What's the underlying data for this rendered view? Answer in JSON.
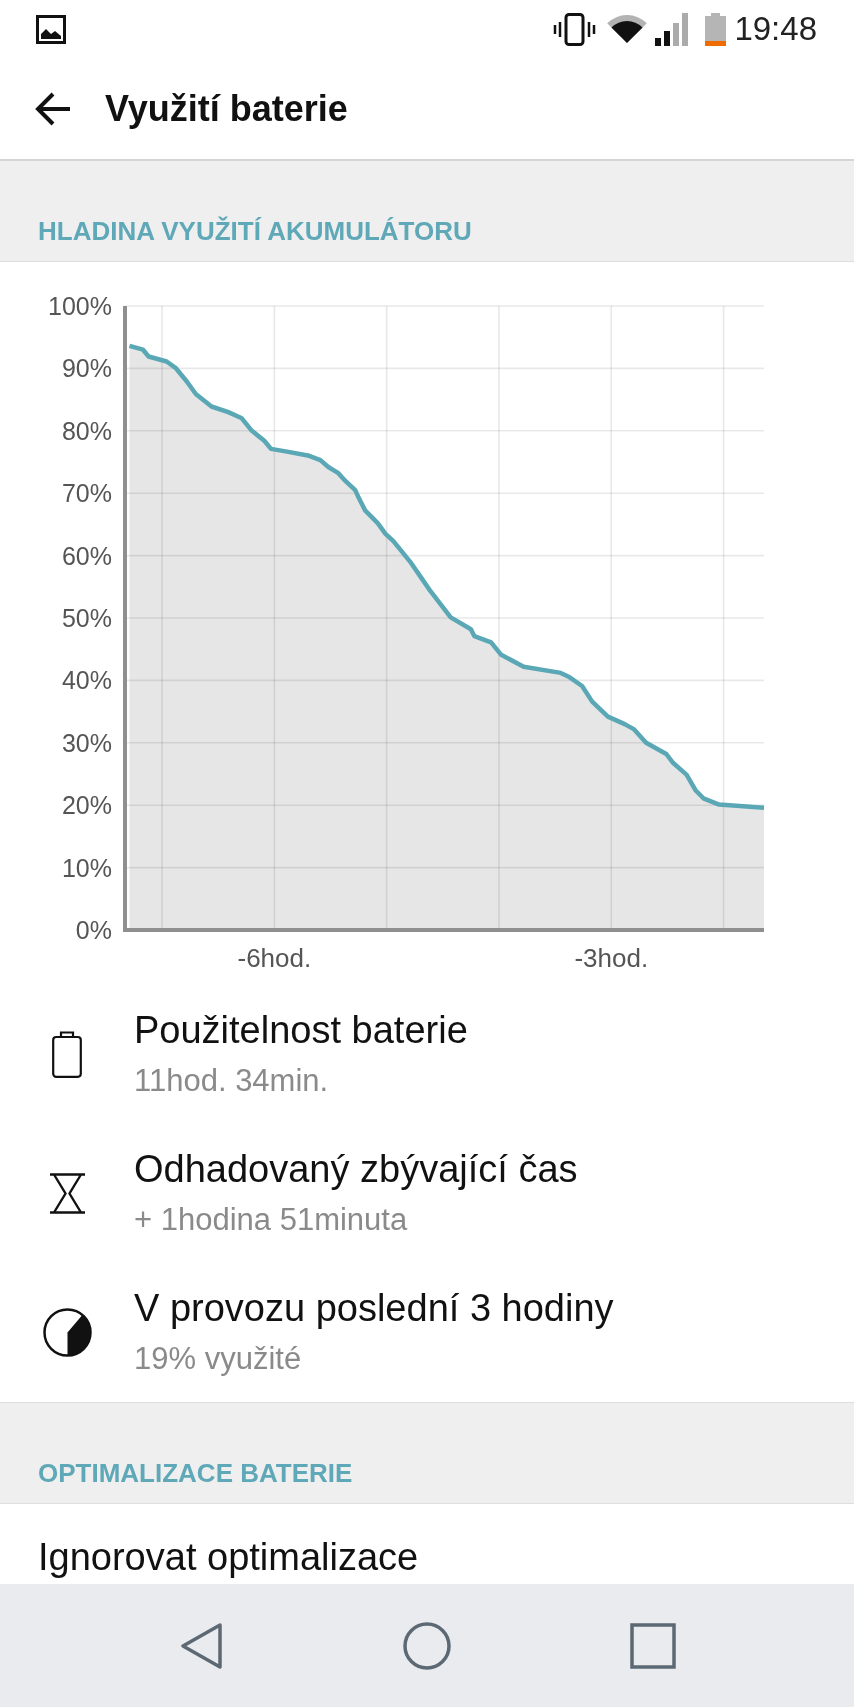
{
  "status_bar": {
    "time": "19:48"
  },
  "app_bar": {
    "title": "Využití baterie"
  },
  "sections": [
    {
      "header": "HLADINA VYUŽITÍ AKUMULÁTORU",
      "chart_data": {
        "type": "area",
        "grid": true,
        "x": [
          -7.29,
          -7.17,
          -7.12,
          -6.96,
          -6.88,
          -6.78,
          -6.7,
          -6.56,
          -6.41,
          -6.29,
          -6.2,
          -6.09,
          -6.03,
          -5.9,
          -5.69,
          -5.59,
          -5.52,
          -5.43,
          -5.37,
          -5.28,
          -5.25,
          -5.19,
          -5.08,
          -5.01,
          -4.94,
          -4.79,
          -4.69,
          -4.61,
          -4.43,
          -4.25,
          -4.22,
          -4.07,
          -3.98,
          -3.78,
          -3.45,
          -3.37,
          -3.26,
          -3.17,
          -3.03,
          -2.88,
          -2.8,
          -2.69,
          -2.51,
          -2.45,
          -2.33,
          -2.25,
          -2.18,
          -2.04,
          -1.64
        ],
        "series": [
          {
            "color": "#5aa7b5",
            "values": [
              93.6,
              93.0,
              91.9,
              91.1,
              90.1,
              87.9,
              85.9,
              83.9,
              83.0,
              82.0,
              80.0,
              78.4,
              77.1,
              76.7,
              76.0,
              75.3,
              74.2,
              73.2,
              72.0,
              70.5,
              69.3,
              67.2,
              65.2,
              63.5,
              62.3,
              59.0,
              56.4,
              54.3,
              50.1,
              48.2,
              47.1,
              46.1,
              44.1,
              42.2,
              41.2,
              40.5,
              39.1,
              36.6,
              34.2,
              33.0,
              32.2,
              30.0,
              28.2,
              26.8,
              24.9,
              22.4,
              21.1,
              20.1,
              19.6
            ]
          }
        ],
        "xlim": [
          -7.33,
          -1.64
        ],
        "ylim": [
          0,
          100
        ],
        "xticks": [
          {
            "value": -6,
            "label": "-6hod."
          },
          {
            "value": -3,
            "label": "-3hod."
          }
        ],
        "yticks": [
          {
            "value": 0,
            "label": "0%"
          },
          {
            "value": 10,
            "label": "10%"
          },
          {
            "value": 20,
            "label": "20%"
          },
          {
            "value": 30,
            "label": "30%"
          },
          {
            "value": 40,
            "label": "40%"
          },
          {
            "value": 50,
            "label": "50%"
          },
          {
            "value": 60,
            "label": "60%"
          },
          {
            "value": 70,
            "label": "70%"
          },
          {
            "value": 80,
            "label": "80%"
          },
          {
            "value": 90,
            "label": "90%"
          },
          {
            "value": 100,
            "label": "100%"
          }
        ]
      },
      "items": [
        {
          "kind": "battery",
          "title": "Použitelnost baterie",
          "subtitle": "11hod. 34min."
        },
        {
          "kind": "hourglass",
          "title": "Odhadovaný zbývající čas",
          "subtitle": "+ 1hodina 51minuta"
        },
        {
          "kind": "pie",
          "title": "V provozu poslední 3 hodiny",
          "subtitle": "19% využité"
        }
      ]
    },
    {
      "header": "OPTIMALIZACE BATERIE",
      "items": [
        {
          "kind": "plain",
          "title": "Ignorovat optimalizace"
        }
      ]
    }
  ]
}
